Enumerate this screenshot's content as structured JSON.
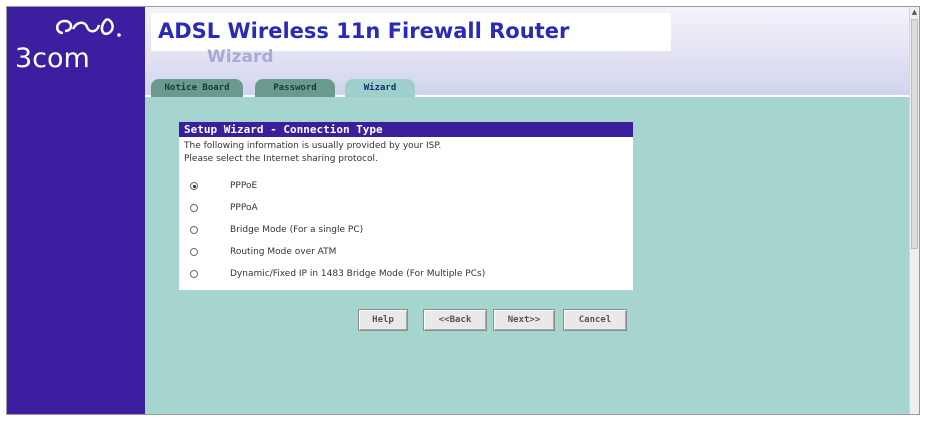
{
  "brand": {
    "logo_text": "3com",
    "logo_icon": "3com-logo-mark"
  },
  "header": {
    "title": "ADSL Wireless 11n Firewall Router",
    "subtitle": "Wizard"
  },
  "tabs": [
    {
      "label": "Notice Board",
      "active": false
    },
    {
      "label": "Password",
      "active": false
    },
    {
      "label": "Wizard",
      "active": true
    }
  ],
  "panel": {
    "title": "Setup Wizard - Connection Type",
    "description_1": "The following information is usually provided by your ISP.",
    "description_2": "Please select the Internet sharing protocol.",
    "options": [
      {
        "label": "PPPoE",
        "selected": true
      },
      {
        "label": "PPPoA",
        "selected": false
      },
      {
        "label": "Bridge Mode (For a single PC)",
        "selected": false
      },
      {
        "label": "Routing Mode over ATM",
        "selected": false
      },
      {
        "label": "Dynamic/Fixed IP in 1483 Bridge Mode (For Multiple PCs)",
        "selected": false
      }
    ]
  },
  "buttons": {
    "help": "Help",
    "back": "<<Back",
    "next": "Next>>",
    "cancel": "Cancel"
  },
  "colors": {
    "sidebar": "#3c1fa0",
    "content_bg": "#a6d5d0",
    "title": "#2a2ab8",
    "panel_header": "#3a1f9a"
  }
}
